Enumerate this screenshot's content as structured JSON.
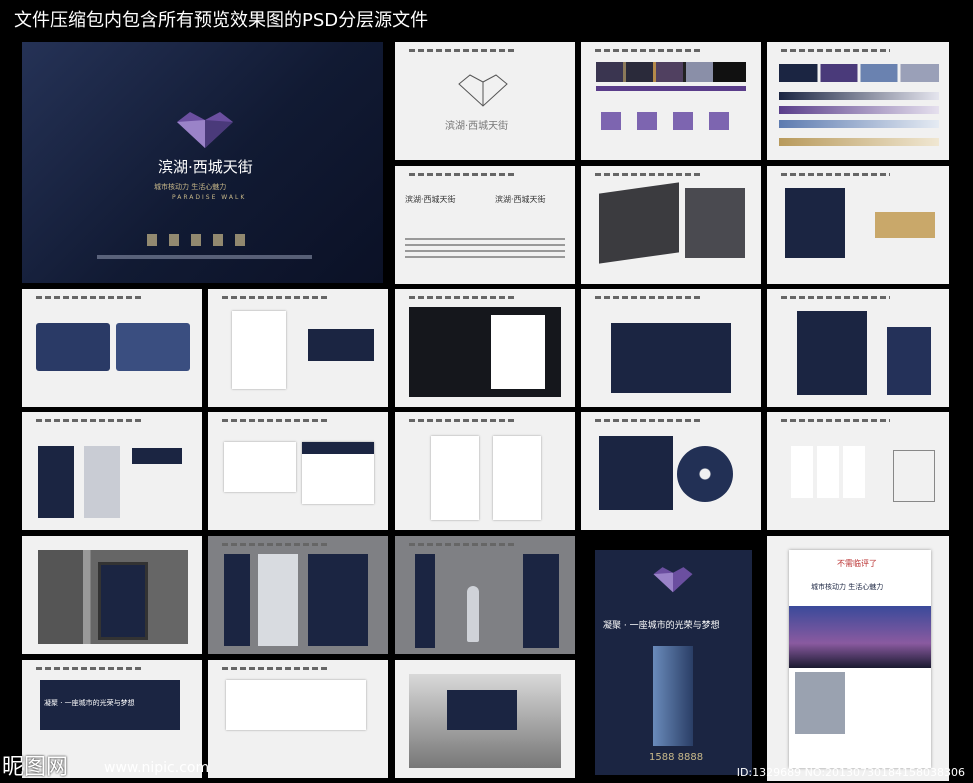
{
  "header": {
    "title": "文件压缩包内包含所有预览效果图的PSD分层源文件"
  },
  "cover": {
    "brand": "滨湖·西城天街",
    "slogan": "城市核动力    生活心魅力",
    "english": "PARADISE WALK"
  },
  "logo_sheet": {
    "brand": "滨湖·西城天街"
  },
  "typography_sheet": {
    "brand_left": "滨湖·西城天街",
    "brand_right": "滨湖·西城天街"
  },
  "poster": {
    "headline": "凝聚 · 一座城市的光荣与梦想",
    "phone": "1588 8888"
  },
  "ad": {
    "title": "不需临评了",
    "body": "城市核动力  生活心魅力"
  },
  "billboard": {
    "line": "凝聚 · 一座城市的光荣与梦想"
  },
  "colors": {
    "navy": "#1b2542",
    "purple": "#5a3d8a",
    "gold": "#b89a5c",
    "bg": "#000000"
  },
  "footer": {
    "site": "昵图网",
    "url": "www.nipic.com",
    "id": "ID:1329689 NO:20130730184158038306"
  }
}
